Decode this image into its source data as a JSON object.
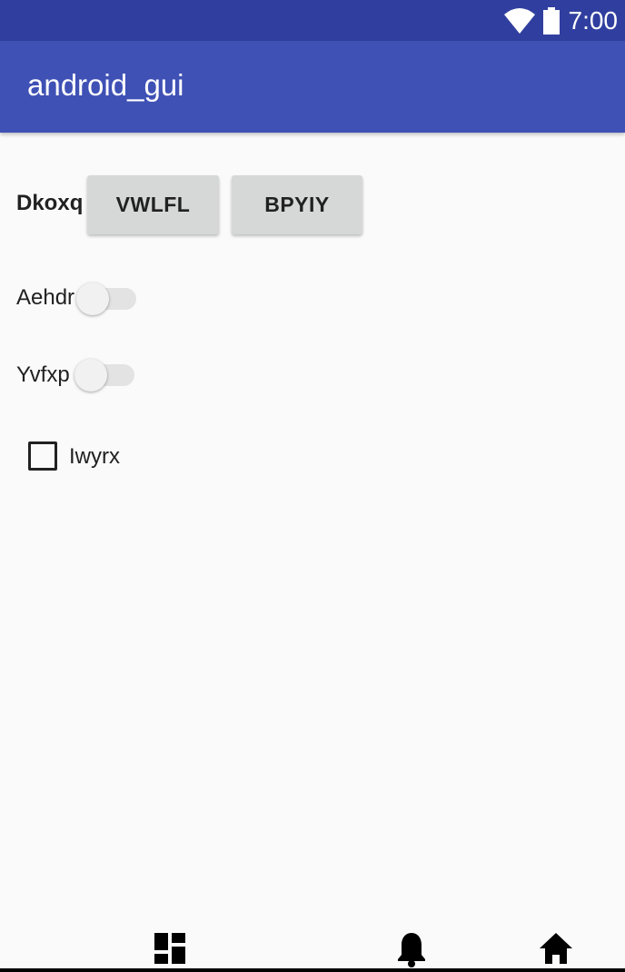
{
  "status_bar": {
    "time": "7:00",
    "wifi_icon": "wifi-icon",
    "battery_icon": "battery-icon"
  },
  "app_bar": {
    "title": "android_gui"
  },
  "row1": {
    "label": "Dkoxq",
    "buttons": [
      "VWLFL",
      "BPYIY"
    ]
  },
  "switches": [
    {
      "label": "Aehdr",
      "checked": false
    },
    {
      "label": "Yvfxp",
      "checked": false
    }
  ],
  "checkbox": {
    "label": "Iwyrx",
    "checked": false
  },
  "bottom_nav": {
    "icons": [
      "dashboard-icon",
      "bell-icon",
      "home-icon"
    ]
  },
  "colors": {
    "status_bar": "#303f9f",
    "app_bar": "#3f51b5",
    "background": "#fafafa",
    "button": "#d6d7d7"
  }
}
